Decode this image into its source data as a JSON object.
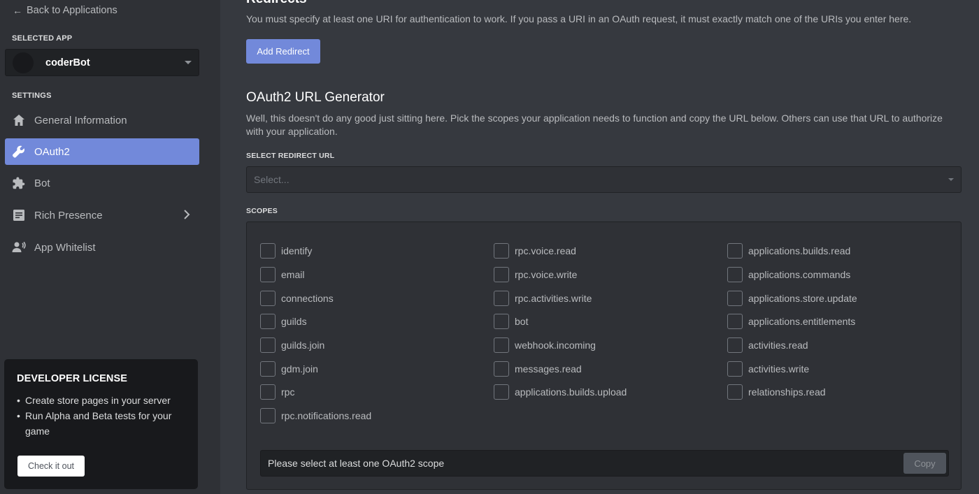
{
  "sidebar": {
    "back_label": "Back to Applications",
    "selected_app_heading": "SELECTED APP",
    "selected_app_name": "coderBot",
    "settings_heading": "SETTINGS",
    "nav": [
      {
        "label": "General Information",
        "icon": "home-icon"
      },
      {
        "label": "OAuth2",
        "icon": "wrench-icon",
        "active": true
      },
      {
        "label": "Bot",
        "icon": "puzzle-icon"
      },
      {
        "label": "Rich Presence",
        "icon": "document-icon"
      },
      {
        "label": "App Whitelist",
        "icon": "person-phone-icon"
      }
    ],
    "license": {
      "title": "DEVELOPER LICENSE",
      "items": [
        "Create store pages in your server",
        "Run Alpha and Beta tests for your game"
      ],
      "button_label": "Check it out"
    }
  },
  "redirects": {
    "title": "Redirects",
    "description": "You must specify at least one URI for authentication to work. If you pass a URI in an OAuth request, it must exactly match one of the URIs you enter here.",
    "add_button_label": "Add Redirect"
  },
  "generator": {
    "title": "OAuth2 URL Generator",
    "description": "Well, this doesn't do any good just sitting here. Pick the scopes your application needs to function and copy the URL below. Others can use that URL to authorize with your application.",
    "redirect_label": "SELECT REDIRECT URL",
    "redirect_placeholder": "Select...",
    "scopes_label": "SCOPES",
    "scopes": {
      "col1": [
        "identify",
        "email",
        "connections",
        "guilds",
        "guilds.join",
        "gdm.join",
        "rpc",
        "rpc.notifications.read"
      ],
      "col2": [
        "rpc.voice.read",
        "rpc.voice.write",
        "rpc.activities.write",
        "bot",
        "webhook.incoming",
        "messages.read",
        "applications.builds.upload"
      ],
      "col3": [
        "applications.builds.read",
        "applications.commands",
        "applications.store.update",
        "applications.entitlements",
        "activities.read",
        "activities.write",
        "relationships.read"
      ]
    },
    "url_text": "Please select at least one OAuth2 scope",
    "copy_label": "Copy"
  },
  "colors": {
    "accent": "#7289da",
    "sidebar_bg": "#2f3136",
    "main_bg": "#36393f"
  }
}
